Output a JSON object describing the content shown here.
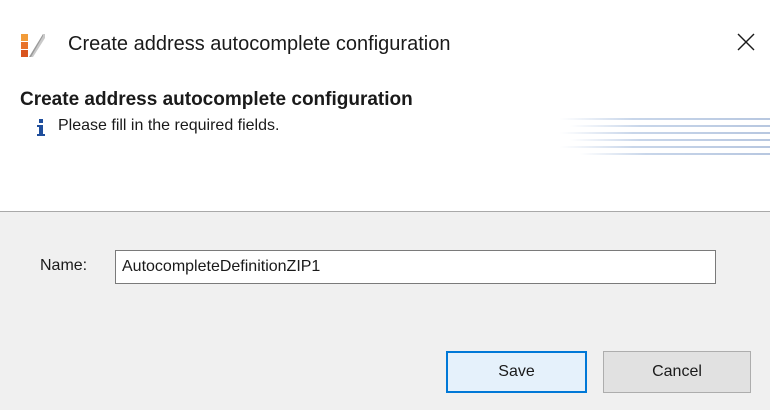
{
  "window": {
    "title": "Create address autocomplete configuration",
    "icon": "app-logo-icon",
    "close_icon": "close-icon"
  },
  "header": {
    "title": "Create address autocomplete configuration",
    "message": "Please fill in the required fields.",
    "info_icon": "info-icon"
  },
  "form": {
    "name_label": "Name:",
    "name_value": "AutocompleteDefinitionZIP1"
  },
  "buttons": {
    "save_label": "Save",
    "cancel_label": "Cancel"
  },
  "colors": {
    "accent": "#0078d7",
    "info": "#1f4e9c",
    "logo_orange": "#e8732a"
  }
}
